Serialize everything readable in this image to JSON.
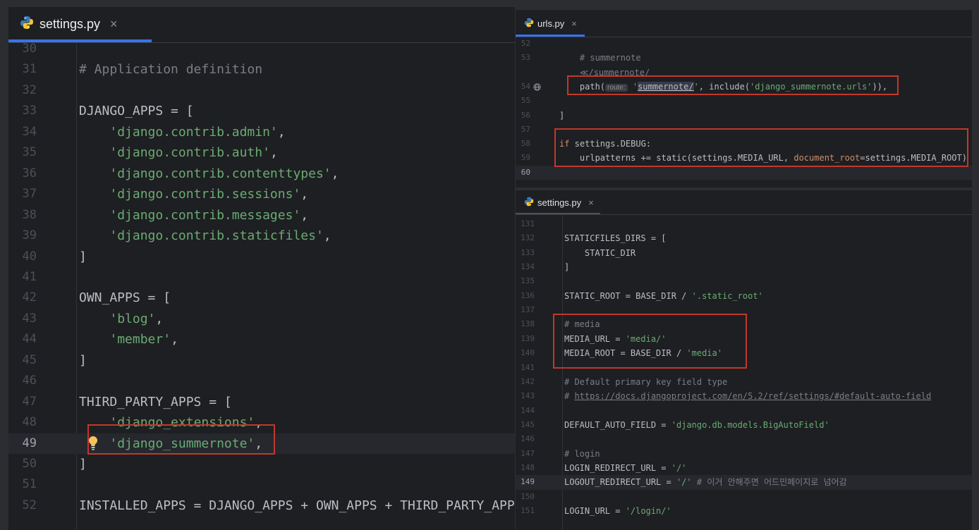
{
  "left_editor": {
    "tab_label": "settings.py",
    "tab_close": "×",
    "lines": [
      {
        "n": "30",
        "segments": []
      },
      {
        "n": "31",
        "segments": [
          {
            "t": "# Application definition",
            "c": "c"
          }
        ]
      },
      {
        "n": "32",
        "segments": []
      },
      {
        "n": "33",
        "segments": [
          {
            "t": "DJANGO_APPS = [",
            "c": ""
          }
        ]
      },
      {
        "n": "34",
        "segments": [
          {
            "t": "    ",
            "c": ""
          },
          {
            "t": "'django.contrib.admin'",
            "c": "s"
          },
          {
            "t": ",",
            "c": ""
          }
        ]
      },
      {
        "n": "35",
        "segments": [
          {
            "t": "    ",
            "c": ""
          },
          {
            "t": "'django.contrib.auth'",
            "c": "s"
          },
          {
            "t": ",",
            "c": ""
          }
        ]
      },
      {
        "n": "36",
        "segments": [
          {
            "t": "    ",
            "c": ""
          },
          {
            "t": "'django.contrib.contenttypes'",
            "c": "s"
          },
          {
            "t": ",",
            "c": ""
          }
        ]
      },
      {
        "n": "37",
        "segments": [
          {
            "t": "    ",
            "c": ""
          },
          {
            "t": "'django.contrib.sessions'",
            "c": "s"
          },
          {
            "t": ",",
            "c": ""
          }
        ]
      },
      {
        "n": "38",
        "segments": [
          {
            "t": "    ",
            "c": ""
          },
          {
            "t": "'django.contrib.messages'",
            "c": "s"
          },
          {
            "t": ",",
            "c": ""
          }
        ]
      },
      {
        "n": "39",
        "segments": [
          {
            "t": "    ",
            "c": ""
          },
          {
            "t": "'django.contrib.staticfiles'",
            "c": "s"
          },
          {
            "t": ",",
            "c": ""
          }
        ]
      },
      {
        "n": "40",
        "segments": [
          {
            "t": "]",
            "c": ""
          }
        ]
      },
      {
        "n": "41",
        "segments": []
      },
      {
        "n": "42",
        "segments": [
          {
            "t": "OWN_APPS = [",
            "c": ""
          }
        ]
      },
      {
        "n": "43",
        "segments": [
          {
            "t": "    ",
            "c": ""
          },
          {
            "t": "'blog'",
            "c": "s"
          },
          {
            "t": ",",
            "c": ""
          }
        ]
      },
      {
        "n": "44",
        "segments": [
          {
            "t": "    ",
            "c": ""
          },
          {
            "t": "'member'",
            "c": "s"
          },
          {
            "t": ",",
            "c": ""
          }
        ]
      },
      {
        "n": "45",
        "segments": [
          {
            "t": "]",
            "c": ""
          }
        ]
      },
      {
        "n": "46",
        "segments": []
      },
      {
        "n": "47",
        "segments": [
          {
            "t": "THIRD_PARTY_APPS = [",
            "c": ""
          }
        ]
      },
      {
        "n": "48",
        "segments": [
          {
            "t": "    ",
            "c": ""
          },
          {
            "t": "'django_extensions'",
            "c": "s"
          },
          {
            "t": ",",
            "c": ""
          }
        ]
      },
      {
        "n": "49",
        "current": true,
        "segments": [
          {
            "t": "    ",
            "c": ""
          },
          {
            "t": "'django_summernote'",
            "c": "s"
          },
          {
            "t": ",",
            "c": ""
          }
        ]
      },
      {
        "n": "50",
        "segments": [
          {
            "t": "]",
            "c": ""
          }
        ]
      },
      {
        "n": "51",
        "segments": []
      },
      {
        "n": "52",
        "segments": [
          {
            "t": "INSTALLED_APPS = DJANGO_APPS + OWN_APPS + THIRD_PARTY_APPS",
            "c": ""
          }
        ]
      }
    ]
  },
  "right_top_editor": {
    "tab_label": "urls.py",
    "tab_close": "×",
    "lines": [
      {
        "n": "52",
        "segments": []
      },
      {
        "n": "53",
        "segments": [
          {
            "t": "    ",
            "c": ""
          },
          {
            "t": "# summernote",
            "c": "c"
          }
        ]
      },
      {
        "n": "",
        "segments": [
          {
            "t": "    ",
            "c": ""
          },
          {
            "t": "≪/summernote/",
            "c": "c"
          }
        ]
      },
      {
        "n": "54",
        "globe": true,
        "segments": [
          {
            "t": "    path(",
            "c": ""
          },
          {
            "t": "route:",
            "c": "hint"
          },
          {
            "t": " ",
            "c": ""
          },
          {
            "t": "'",
            "c": "s"
          },
          {
            "t": "summernote/",
            "c": "hl"
          },
          {
            "t": "'",
            "c": "s"
          },
          {
            "t": ", include(",
            "c": ""
          },
          {
            "t": "'django_summernote.urls'",
            "c": "s"
          },
          {
            "t": ")),",
            "c": ""
          }
        ]
      },
      {
        "n": "55",
        "segments": []
      },
      {
        "n": "56",
        "segments": [
          {
            "t": "]",
            "c": ""
          }
        ]
      },
      {
        "n": "57",
        "segments": []
      },
      {
        "n": "58",
        "segments": [
          {
            "t": "if",
            "c": "k"
          },
          {
            "t": " settings.DEBUG:",
            "c": ""
          }
        ]
      },
      {
        "n": "59",
        "segments": [
          {
            "t": "    urlpatterns += static(settings.MEDIA_URL, ",
            "c": ""
          },
          {
            "t": "document_root",
            "c": "k"
          },
          {
            "t": "=settings.MEDIA_ROOT)",
            "c": ""
          }
        ]
      },
      {
        "n": "60",
        "current": true,
        "segments": []
      }
    ]
  },
  "right_bottom_editor": {
    "tab_label": "settings.py",
    "tab_close": "×",
    "lines": [
      {
        "n": "131",
        "segments": []
      },
      {
        "n": "132",
        "segments": [
          {
            "t": "STATICFILES_DIRS = [",
            "c": ""
          }
        ]
      },
      {
        "n": "133",
        "segments": [
          {
            "t": "    STATIC_DIR",
            "c": ""
          }
        ]
      },
      {
        "n": "134",
        "segments": [
          {
            "t": "]",
            "c": ""
          }
        ]
      },
      {
        "n": "135",
        "segments": []
      },
      {
        "n": "136",
        "segments": [
          {
            "t": "STATIC_ROOT = BASE_DIR / ",
            "c": ""
          },
          {
            "t": "'.static_root'",
            "c": "s"
          }
        ]
      },
      {
        "n": "137",
        "segments": []
      },
      {
        "n": "138",
        "segments": [
          {
            "t": "# media",
            "c": "c"
          }
        ]
      },
      {
        "n": "139",
        "segments": [
          {
            "t": "MEDIA_URL = ",
            "c": ""
          },
          {
            "t": "'media/'",
            "c": "s"
          }
        ]
      },
      {
        "n": "140",
        "segments": [
          {
            "t": "MEDIA_ROOT = BASE_DIR / ",
            "c": ""
          },
          {
            "t": "'media'",
            "c": "s"
          }
        ]
      },
      {
        "n": "141",
        "segments": []
      },
      {
        "n": "142",
        "segments": [
          {
            "t": "# Default primary key field type",
            "c": "c"
          }
        ]
      },
      {
        "n": "143",
        "segments": [
          {
            "t": "# ",
            "c": "c"
          },
          {
            "t": "https://docs.djangoproject.com/en/5.2/ref/settings/#default-auto-field",
            "c": "lnk"
          }
        ]
      },
      {
        "n": "144",
        "segments": []
      },
      {
        "n": "145",
        "segments": [
          {
            "t": "DEFAULT_AUTO_FIELD = ",
            "c": ""
          },
          {
            "t": "'django.db.models.BigAutoField'",
            "c": "s"
          }
        ]
      },
      {
        "n": "146",
        "segments": []
      },
      {
        "n": "147",
        "segments": [
          {
            "t": "# login",
            "c": "c"
          }
        ]
      },
      {
        "n": "148",
        "segments": [
          {
            "t": "LOGIN_REDIRECT_URL = ",
            "c": ""
          },
          {
            "t": "'/'",
            "c": "s"
          }
        ]
      },
      {
        "n": "149",
        "current": true,
        "segments": [
          {
            "t": "LOGOUT_REDIRECT_URL = ",
            "c": ""
          },
          {
            "t": "'/'",
            "c": "s"
          },
          {
            "t": " # 이거 안해주면 어드민페이지로 넘어감",
            "c": "c"
          }
        ]
      },
      {
        "n": "150",
        "segments": []
      },
      {
        "n": "151",
        "segments": [
          {
            "t": "LOGIN_URL = ",
            "c": ""
          },
          {
            "t": "'/login/'",
            "c": "s"
          }
        ]
      }
    ]
  },
  "colors": {
    "highlight_box": "#c0392b",
    "accent": "#3574f0",
    "string": "#6aab73",
    "comment": "#7a7e85",
    "keyword": "#cf8e6d"
  },
  "icons": {
    "python": "python-file-icon",
    "bulb": "lightbulb-intention-icon",
    "globe": "globe-endpoint-icon"
  }
}
